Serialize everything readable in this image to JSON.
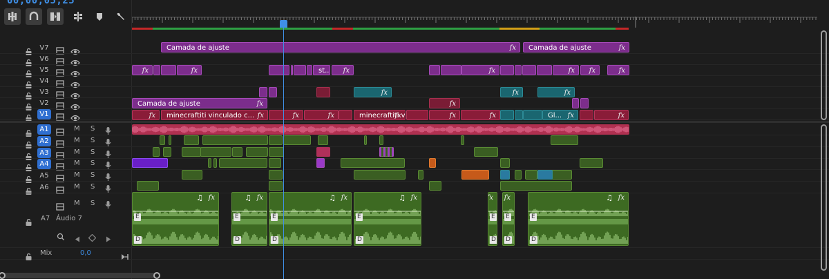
{
  "timecode": "00;00;05;25",
  "toolbar": [
    {
      "name": "insert-sequence-icon",
      "on": true
    },
    {
      "name": "snap-icon",
      "on": true
    },
    {
      "name": "linked-selection-icon",
      "on": true
    },
    {
      "name": "add-marker-icon",
      "on": false
    },
    {
      "name": "marker-icon",
      "on": false
    },
    {
      "name": "wrench-icon",
      "on": false
    }
  ],
  "video_tracks": [
    {
      "id": "V7",
      "selected": false
    },
    {
      "id": "V6",
      "selected": false
    },
    {
      "id": "V5",
      "selected": false
    },
    {
      "id": "V4",
      "selected": false
    },
    {
      "id": "V3",
      "selected": false
    },
    {
      "id": "V2",
      "selected": false
    },
    {
      "id": "V1",
      "selected": true
    }
  ],
  "audio_tracks": [
    {
      "id": "A1",
      "selected": true
    },
    {
      "id": "A2",
      "selected": true
    },
    {
      "id": "A3",
      "selected": true
    },
    {
      "id": "A4",
      "selected": true
    },
    {
      "id": "A5",
      "selected": false
    },
    {
      "id": "A6",
      "selected": false
    }
  ],
  "a7": {
    "id": "A7",
    "name": "Áudio 7",
    "m": "M",
    "s": "S"
  },
  "mix": {
    "label": "Mix",
    "value": "0,0"
  },
  "track_buttons": {
    "m": "M",
    "s": "S"
  },
  "clip_labels": {
    "adjust1": "Camada de ajuste",
    "adjust2": "Camada de ajuste",
    "adjust3": "Camada de ajuste",
    "st": "st...",
    "mc1": "minecraftiti vinculado c...",
    "mc2": "minecraftiti vi...",
    "gl": "Gl...",
    "fx": "fx"
  },
  "clip_badges": {
    "e": "E",
    "d": "D"
  },
  "colors": {
    "accent": "#2f6fd1",
    "playhead": "#3f8fe6",
    "video_purple": "#7c2d8c",
    "video_red": "#8a1c38",
    "video_teal": "#1a6670",
    "audio_green": "#3a5e22",
    "audio_pink": "#b03050"
  }
}
